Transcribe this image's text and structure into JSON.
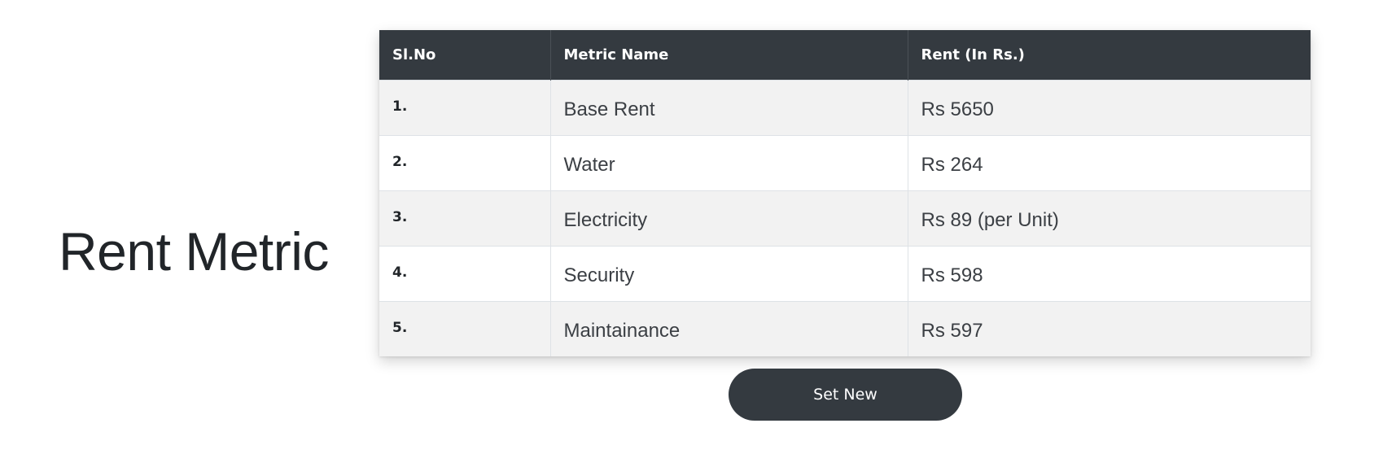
{
  "page": {
    "title": "Rent Metric"
  },
  "table": {
    "headers": [
      "Sl.No",
      "Metric Name",
      "Rent (In Rs.)"
    ],
    "rows": [
      {
        "sl": "1.",
        "name": "Base Rent",
        "rent": "Rs 5650"
      },
      {
        "sl": "2.",
        "name": "Water",
        "rent": "Rs 264"
      },
      {
        "sl": "3.",
        "name": "Electricity",
        "rent": "Rs 89 (per Unit)"
      },
      {
        "sl": "4.",
        "name": "Security",
        "rent": "Rs 598"
      },
      {
        "sl": "5.",
        "name": "Maintainance",
        "rent": "Rs 597"
      }
    ]
  },
  "actions": {
    "set_new_label": "Set New"
  },
  "colors": {
    "header_bg": "#343a40",
    "row_stripe": "#f2f2f2",
    "button_bg": "#343a40"
  }
}
